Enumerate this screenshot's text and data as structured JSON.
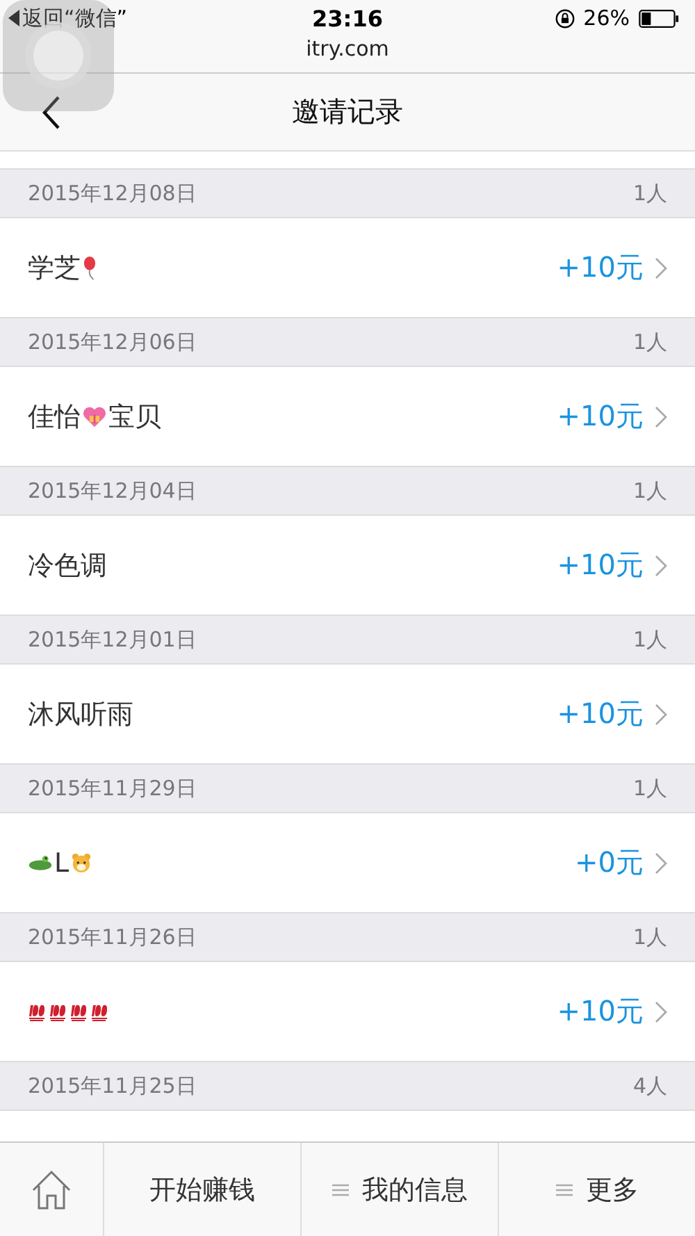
{
  "status_bar": {
    "back_label": "返回“微信”",
    "time": "23:16",
    "battery": "26%"
  },
  "address": "itry.com",
  "header": {
    "title": "邀请记录"
  },
  "groups": [
    {
      "date": "2015年12月08日",
      "count": "1人",
      "name_parts": [
        {
          "kind": "text",
          "text": "学芝"
        },
        {
          "kind": "balloon"
        }
      ],
      "reward": "+10元"
    },
    {
      "date": "2015年12月06日",
      "count": "1人",
      "name_parts": [
        {
          "kind": "text",
          "text": "佳怡"
        },
        {
          "kind": "heart"
        },
        {
          "kind": "text",
          "text": "宝贝"
        }
      ],
      "reward": "+10元"
    },
    {
      "date": "2015年12月04日",
      "count": "1人",
      "name_parts": [
        {
          "kind": "text",
          "text": "冷色调"
        }
      ],
      "reward": "+10元"
    },
    {
      "date": "2015年12月01日",
      "count": "1人",
      "name_parts": [
        {
          "kind": "text",
          "text": "沐风听雨"
        }
      ],
      "reward": "+10元"
    },
    {
      "date": "2015年11月29日",
      "count": "1人",
      "name_parts": [
        {
          "kind": "crocodile"
        },
        {
          "kind": "text",
          "text": "L"
        },
        {
          "kind": "tiger"
        }
      ],
      "reward": "+0元"
    },
    {
      "date": "2015年11月26日",
      "count": "1人",
      "name_parts": [
        {
          "kind": "hundred"
        },
        {
          "kind": "hundred"
        },
        {
          "kind": "hundred"
        },
        {
          "kind": "hundred"
        }
      ],
      "reward": "+10元"
    },
    {
      "date": "2015年11月25日",
      "count": "4人"
    }
  ],
  "tab_bar": [
    {
      "kind": "home"
    },
    {
      "kind": "label",
      "text": "开始赚钱"
    },
    {
      "kind": "menu",
      "text": "我的信息"
    },
    {
      "kind": "menu",
      "text": "更多"
    }
  ]
}
